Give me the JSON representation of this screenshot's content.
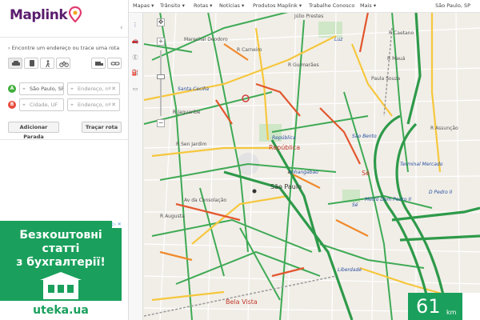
{
  "brand": {
    "name": "Maplink"
  },
  "nav": {
    "items": [
      "Mapas ▾",
      "Trânsito ▾",
      "Rotas ▾",
      "Notícias ▾",
      "Produtos Maplink ▾",
      "Trabalhe Conosco",
      "Mais ▾"
    ],
    "city": "São Paulo, SP"
  },
  "panel": {
    "find_text": "Encontre um endereço ou trace uma rota",
    "modes": [
      "car-icon",
      "bus-icon",
      "walk-icon",
      "bike-icon"
    ],
    "extra_modes": [
      "truck-icon",
      "link-icon"
    ],
    "waypoint_a": {
      "letter": "A",
      "city_value": "São Paulo, SP",
      "address_placeholder": "Endereço, nº"
    },
    "waypoint_b": {
      "letter": "B",
      "city_placeholder": "Cidade, UF",
      "address_placeholder": "Endereço, nº"
    },
    "add_stop": "Adicionar Parada",
    "trace_route": "Traçar rota"
  },
  "ad": {
    "line1": "Безкоштовні",
    "line2": "статті",
    "line3": "з бухгалтерії!",
    "brand": "uteka.ua",
    "close": "▷ ✕"
  },
  "map": {
    "labels": {
      "julio_prestes": "Júlio Prestes",
      "mal_deodoro": "Marechal Deodoro",
      "santa_cecilia": "Santa Cecília",
      "republica_st": "República",
      "republica": "República",
      "anhangabau": "Anhangabaú",
      "sao_paulo": "São Paulo",
      "se_st": "Sé",
      "se": "Sé",
      "sao_bento": "São Bento",
      "luz": "Luz",
      "term_mercado": "Terminal Mercado",
      "pedro_ii": "D Pedro II",
      "metro_pedro": "Metrô Dom Pedro II",
      "liberdade": "Liberdade",
      "bela_vista": "Bela Vista",
      "r_caetano": "R Caetano",
      "r_maua": "R Mauá",
      "r_paula_souza": "Paula Souza",
      "r_assuncao": "R Assunção",
      "r_jaguaribe": "R Jaguaribe",
      "r_augusta": "R Augusta",
      "av_consolacao": "Av da Consolação",
      "r_jardim": "R Sen Jardim",
      "r_guimaraes": "R Guimarães",
      "r_carneiro": "R Carneiro",
      "r_pedro": "Pedro"
    }
  },
  "speed": {
    "value": "61",
    "unit": "km"
  }
}
